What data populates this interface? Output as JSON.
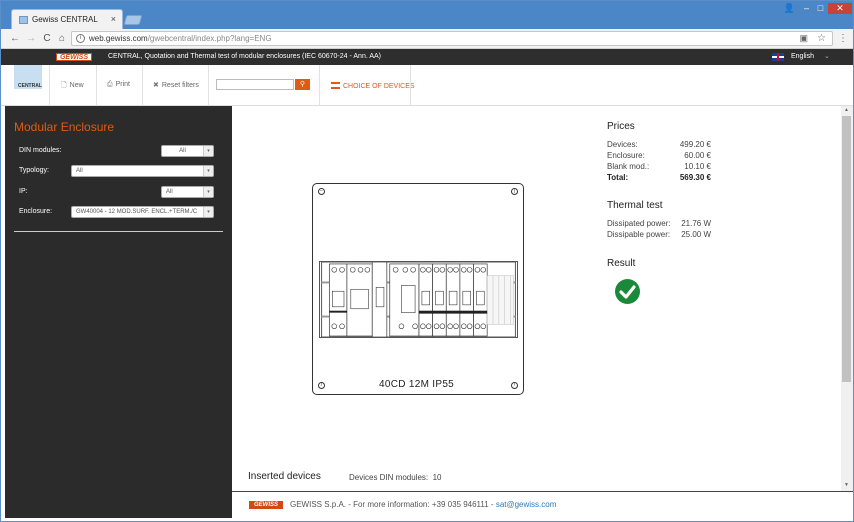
{
  "browser": {
    "tab_title": "Gewiss CENTRAL",
    "tab_close": "×",
    "window_controls": {
      "user": "👤",
      "minimize": "‒",
      "maximize": "□",
      "close": "✕"
    },
    "nav": {
      "back": "←",
      "forward": "→",
      "reload": "C",
      "home": "⌂"
    },
    "url_domain": "web.gewiss.com",
    "url_path": "/gwebcentral/index.php?lang=ENG",
    "menu": "⋮"
  },
  "topbar": {
    "brand": "GEWISS",
    "title": "CENTRAL, Quotation and Thermal test of modular enclosures (IEC 60670-24 - Ann. AA)",
    "language": "English",
    "language_caret": "⌄"
  },
  "header": {
    "logo_text": "CENTRAL",
    "new_label": "New",
    "print_label": "Print",
    "reset_label": "Reset filters",
    "search_placeholder": "",
    "search_icon": "🔍",
    "choice_label": "CHOICE OF DEVICES"
  },
  "sidebar": {
    "title": "Modular Enclosure",
    "filters": [
      {
        "label": "DIN modules:",
        "value": "All"
      },
      {
        "label": "Typology:",
        "value": "All"
      },
      {
        "label": "IP:",
        "value": "All"
      },
      {
        "label": "Enclosure:",
        "value": "GW40004 - 12 MOD.SURF. ENCL.+TERM./C"
      }
    ]
  },
  "enclosure": {
    "label": "40CD  12M  IP55"
  },
  "prices": {
    "heading": "Prices",
    "rows": [
      {
        "label": "Devices:",
        "value": "499.20 €"
      },
      {
        "label": "Enclosure:",
        "value": "60.00 €"
      },
      {
        "label": "Blank mod.:",
        "value": "10.10 €"
      },
      {
        "label": "Total:",
        "value": "569.30 €"
      }
    ]
  },
  "thermal": {
    "heading": "Thermal test",
    "rows": [
      {
        "label": "Dissipated power:",
        "value": "21.76 W"
      },
      {
        "label": "Dissipable power:",
        "value": "25.00 W"
      }
    ]
  },
  "result": {
    "heading": "Result",
    "status": "ok",
    "status_color": "#1a8a3a"
  },
  "inserted": {
    "heading": "Inserted devices",
    "din_label": "Devices DIN modules:",
    "din_value": "10"
  },
  "footer": {
    "brand": "GEWISS",
    "text": "GEWISS S.p.A. - For more information: ",
    "phone": "+39 035 946111",
    "sep": " - ",
    "email": "sat@gewiss.com"
  },
  "colors": {
    "accent": "#e05a14",
    "sidebar_bg": "#2b2b2b",
    "chrome_blue": "#4b86c6"
  }
}
